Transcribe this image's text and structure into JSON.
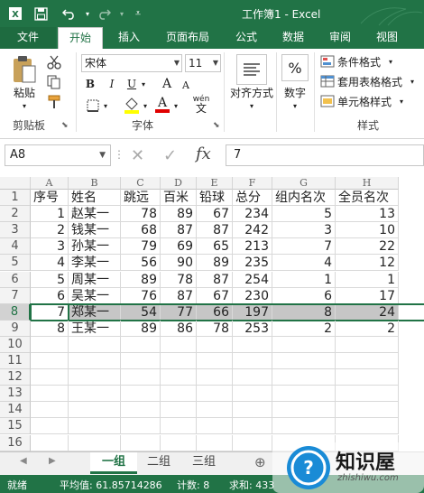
{
  "app": {
    "title": "工作簿1 - Excel",
    "accent": "#217346"
  },
  "quick_access": {
    "icons": [
      "excel-logo-icon",
      "save-icon",
      "undo-icon",
      "redo-icon"
    ]
  },
  "ribbon_tabs": [
    "文件",
    "开始",
    "插入",
    "页面布局",
    "公式",
    "数据",
    "审阅",
    "视图"
  ],
  "ribbon": {
    "clipboard": {
      "paste_label": "粘贴",
      "group_label": "剪贴板"
    },
    "font": {
      "font_name": "宋体",
      "font_size": "11",
      "group_label": "字体",
      "bold": "B",
      "italic": "I",
      "underline": "U",
      "grow": "A",
      "shrink": "A",
      "font_color": "A",
      "phonetic": "wén"
    },
    "alignment": {
      "label": "对齐方式"
    },
    "number": {
      "label": "数字",
      "symbol": "%"
    },
    "styles": {
      "conditional": "条件格式",
      "table_format": "套用表格格式",
      "cell_styles": "单元格样式",
      "group_label": "样式"
    }
  },
  "formula_bar": {
    "name_box": "A8",
    "fx": "fx",
    "value": "7"
  },
  "columns": [
    "A",
    "B",
    "C",
    "D",
    "E",
    "F",
    "G",
    "H"
  ],
  "rows": [
    [
      "序号",
      "姓名",
      "跳远",
      "百米",
      "铅球",
      "总分",
      "组内名次",
      "全员名次"
    ],
    [
      "1",
      "赵某一",
      "78",
      "89",
      "67",
      "234",
      "5",
      "13"
    ],
    [
      "2",
      "钱某一",
      "68",
      "87",
      "87",
      "242",
      "3",
      "10"
    ],
    [
      "3",
      "孙某一",
      "79",
      "69",
      "65",
      "213",
      "7",
      "22"
    ],
    [
      "4",
      "李某一",
      "56",
      "90",
      "89",
      "235",
      "4",
      "12"
    ],
    [
      "5",
      "周某一",
      "89",
      "78",
      "87",
      "254",
      "1",
      "1"
    ],
    [
      "6",
      "吴某一",
      "76",
      "87",
      "67",
      "230",
      "6",
      "17"
    ],
    [
      "7",
      "郑某一",
      "54",
      "77",
      "66",
      "197",
      "8",
      "24"
    ],
    [
      "8",
      "王某一",
      "89",
      "86",
      "78",
      "253",
      "2",
      "2"
    ],
    [
      "",
      "",
      "",
      "",
      "",
      "",
      "",
      ""
    ],
    [
      "",
      "",
      "",
      "",
      "",
      "",
      "",
      ""
    ],
    [
      "",
      "",
      "",
      "",
      "",
      "",
      "",
      ""
    ],
    [
      "",
      "",
      "",
      "",
      "",
      "",
      "",
      ""
    ],
    [
      "",
      "",
      "",
      "",
      "",
      "",
      "",
      ""
    ],
    [
      "",
      "",
      "",
      "",
      "",
      "",
      "",
      ""
    ],
    [
      "",
      "",
      "",
      "",
      "",
      "",
      "",
      ""
    ]
  ],
  "row_numbers": [
    "1",
    "2",
    "3",
    "4",
    "5",
    "6",
    "7",
    "8",
    "9",
    "10",
    "11",
    "12",
    "13",
    "14",
    "15",
    "16"
  ],
  "selected_row": 8,
  "sheets": [
    "一组",
    "二组",
    "三组"
  ],
  "active_sheet": 0,
  "status": {
    "mode": "就绪",
    "average": "平均值: 61.85714286",
    "count": "计数: 8",
    "sum": "求和: 433"
  },
  "watermark": {
    "brand": "知识屋",
    "url": "zhishiwu.com"
  }
}
